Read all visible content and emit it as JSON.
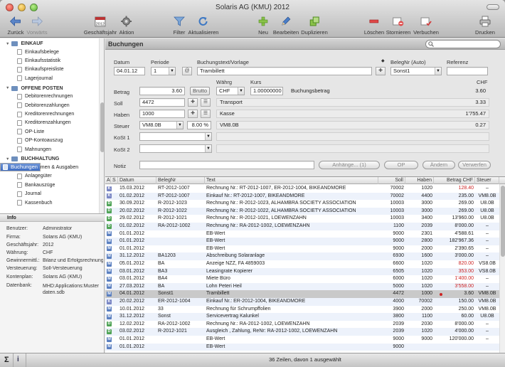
{
  "window": {
    "title": "Solaris AG (KMU) 2012"
  },
  "toolbar": {
    "items": [
      {
        "id": "back",
        "label": "Zurück",
        "icon": "back-arrow-icon",
        "enabled": true
      },
      {
        "id": "forward",
        "label": "Vorwärts",
        "icon": "forward-arrow-icon",
        "enabled": false
      },
      {
        "id": "fiscal",
        "label": "Geschäftsjahr",
        "icon": "calendar-icon",
        "enabled": true
      },
      {
        "id": "action",
        "label": "Aktion",
        "icon": "gear-icon",
        "enabled": true
      },
      {
        "id": "filter",
        "label": "Filter",
        "icon": "filter-icon",
        "enabled": true
      },
      {
        "id": "refresh",
        "label": "Aktualisieren",
        "icon": "refresh-icon",
        "enabled": true
      },
      {
        "id": "new",
        "label": "Neu",
        "icon": "plus-icon",
        "enabled": true
      },
      {
        "id": "edit",
        "label": "Bearbeiten",
        "icon": "pencil-icon",
        "enabled": true
      },
      {
        "id": "duplicate",
        "label": "Duplizieren",
        "icon": "duplicate-icon",
        "enabled": true
      },
      {
        "id": "delete",
        "label": "Löschen",
        "icon": "minus-icon",
        "enabled": true
      },
      {
        "id": "cancel",
        "label": "Stornieren",
        "icon": "cancel-icon",
        "enabled": true
      },
      {
        "id": "post",
        "label": "Verbuchen",
        "icon": "post-icon",
        "enabled": true
      },
      {
        "id": "print",
        "label": "Drucken",
        "icon": "printer-icon",
        "enabled": true
      }
    ]
  },
  "sidebar": {
    "groups": [
      {
        "title": "EINKAUF",
        "items": [
          "Einkaufsbelege",
          "Einkaufsstatistik",
          "Einkaufspreisliste",
          "Lagerjournal"
        ]
      },
      {
        "title": "OFFENE POSTEN",
        "items": [
          "Debitorenrechnungen",
          "Debitorenzahlungen",
          "Kreditorenrechnungen",
          "Kreditorenzahlungen",
          "OP-Liste",
          "OP-Kontoauszug",
          "Mahnungen"
        ]
      },
      {
        "title": "BUCHHALTUNG",
        "items": [
          "Buchungen",
          "Einnahmen & Ausgaben",
          "Anlagegüter",
          "Bankauszüge",
          "Journal",
          "Kassenbuch"
        ]
      }
    ],
    "selected": "Buchungen"
  },
  "info": {
    "title": "Info",
    "rows": [
      {
        "k": "Benutzer:",
        "v": "Administrator"
      },
      {
        "k": "Firma:",
        "v": "Solaris AG (KMU)"
      },
      {
        "k": "Geschäftsjahr:",
        "v": "2012"
      },
      {
        "k": "Währung:",
        "v": "CHF"
      },
      {
        "k": "Gewinnermittl.:",
        "v": "Bilanz und Erfolgsrechnung"
      },
      {
        "k": "Versteuerung:",
        "v": "Soll-Versteuerung"
      },
      {
        "k": "Kontenplan:",
        "v": "Solaris AG (KMU)"
      },
      {
        "k": "Datenbank:",
        "v": "MHD:Applications:Muster daten.sdb"
      }
    ]
  },
  "main": {
    "title": "Buchungen",
    "search_placeholder": ""
  },
  "form": {
    "datum_label": "Datum",
    "datum": "04.01.12",
    "periode_label": "Periode",
    "periode": "1",
    "text_label": "Buchungstext/Vorlage",
    "text": "Trambillett",
    "beleg_label": "BelegNr (Auto)",
    "beleg": "Sonst1",
    "referenz_label": "Referenz",
    "referenz": "",
    "waehrung_label": "Währg",
    "waehrung": "CHF",
    "kurs_label": "Kurs",
    "kurs": "1.00000000",
    "betrag_label": "Betrag",
    "betrag": "3.60",
    "brutto_label": "Brutto",
    "buchungsbetrag_label": "Buchungsbetrag",
    "buchungsbetrag": "3.60",
    "chf_label": "CHF",
    "soll_label": "Soll",
    "soll": "4472",
    "soll_name": "Transport",
    "soll_value": "3.33",
    "haben_label": "Haben",
    "haben": "1000",
    "haben_name": "Kasse",
    "haben_value": "1'755.47",
    "steuer_label": "Steuer",
    "steuer": "VM8.0B",
    "steuer_pct": "8.00 %",
    "steuer_code": "VM8.0B",
    "steuer_value": "0.27",
    "kost1_label": "KoSt 1",
    "kost2_label": "KoSt 2",
    "notiz_label": "Notiz",
    "btn_anhaenge": "Anhänge... (1)",
    "btn_op": "OP",
    "btn_aendern": "Ändern",
    "btn_verwerfen": "Verwerfen"
  },
  "table": {
    "columns": [
      "A",
      "S",
      "Datum",
      "BelegNr",
      "Text",
      "Soll",
      "Haben",
      "Betrag CHF",
      "Steuer"
    ],
    "rows": [
      {
        "a": "K",
        "datum": "15.03.2012",
        "beleg": "RT-2012-1007",
        "text": "Rechnung Nr.: RT-2012-1007, ER-2012-1004, BIKEANDMORE",
        "soll": "70002",
        "haben": "1020",
        "betrag": "128.40",
        "neg": true,
        "steuer": "–"
      },
      {
        "a": "K",
        "datum": "01.02.2012",
        "beleg": "RT-2012-1007",
        "text": "Einkauf Nr.: RT-2012-1007, BIKEANDMORE",
        "soll": "70002",
        "haben": "4400",
        "betrag": "235.00",
        "neg": false,
        "steuer": "VM8.0B"
      },
      {
        "a": "D",
        "datum": "30.09.2012",
        "beleg": "R-2012-1023",
        "text": "Rechnung Nr.: R-2012-1023, ALHAMBRA SOCIETY ASSOCIATION",
        "soll": "10003",
        "haben": "3000",
        "betrag": "269.00",
        "neg": false,
        "steuer": "U8.0B"
      },
      {
        "a": "D",
        "datum": "20.02.2012",
        "beleg": "R-2012-1022",
        "text": "Rechnung Nr.: R-2012-1022, ALHAMBRA SOCIETY ASSOCIATION",
        "soll": "10003",
        "haben": "3000",
        "betrag": "269.00",
        "neg": false,
        "steuer": "U8.0B"
      },
      {
        "a": "D",
        "datum": "29.02.2012",
        "beleg": "R-2012-1021",
        "text": "Rechnung Nr.: R-2012-1021, LOEWENZAHN",
        "soll": "10003",
        "haben": "3400",
        "betrag": "13'960.00",
        "neg": false,
        "steuer": "U8.0B"
      },
      {
        "a": "D",
        "datum": "01.02.2012",
        "beleg": "RA-2012-1002",
        "text": "Rechnung Nr.: RA-2012-1002, LOEWENZAHN",
        "soll": "1100",
        "haben": "2039",
        "betrag": "8'000.00",
        "neg": false,
        "steuer": "–"
      },
      {
        "a": "M",
        "datum": "01.01.2012",
        "beleg": "",
        "text": "EB-Wert",
        "soll": "9000",
        "haben": "2301",
        "betrag": "4'588.61",
        "neg": false,
        "steuer": "–"
      },
      {
        "a": "M",
        "datum": "01.01.2012",
        "beleg": "",
        "text": "EB-Wert",
        "soll": "9000",
        "haben": "2800",
        "betrag": "182'967.36",
        "neg": false,
        "steuer": "–"
      },
      {
        "a": "M",
        "datum": "01.01.2012",
        "beleg": "",
        "text": "EB-Wert",
        "soll": "9000",
        "haben": "2000",
        "betrag": "2'390.65",
        "neg": false,
        "steuer": "–"
      },
      {
        "a": "M",
        "datum": "31.12.2012",
        "beleg": "BA1203",
        "text": "Abschreibung Solaranlage",
        "soll": "6930",
        "haben": "1600",
        "betrag": "3'000.00",
        "neg": false,
        "steuer": "–"
      },
      {
        "a": "M",
        "datum": "05.01.2012",
        "beleg": "BA",
        "text": "Anzeige NZZ, FA 4859003",
        "soll": "6600",
        "haben": "1020",
        "betrag": "820.00",
        "neg": true,
        "steuer": "VS8.0B"
      },
      {
        "a": "M",
        "datum": "03.01.2012",
        "beleg": "BA3",
        "text": "Leasingrate Kopierer",
        "soll": "6505",
        "haben": "1020",
        "betrag": "353.00",
        "neg": true,
        "steuer": "VS8.0B"
      },
      {
        "a": "M",
        "datum": "03.01.2012",
        "beleg": "BA4",
        "text": "Miete Büro",
        "soll": "6000",
        "haben": "1020",
        "betrag": "1'400.00",
        "neg": true,
        "steuer": "–"
      },
      {
        "a": "M",
        "datum": "27.03.2012",
        "beleg": "BA",
        "text": "Lohn Peteri Heil",
        "soll": "5000",
        "haben": "1020",
        "betrag": "3'558.00",
        "neg": true,
        "steuer": "–"
      },
      {
        "a": "M",
        "datum": "04.01.2012",
        "beleg": "Sonst1",
        "text": "Trambillett",
        "soll": "4472",
        "haben": "1000",
        "betrag": "3.60",
        "neg": false,
        "steuer": "VM8.0B",
        "selected": true
      },
      {
        "a": "K",
        "datum": "20.02.2012",
        "beleg": "ER-2012-1004",
        "text": "Einkauf Nr.: ER-2012-1004, BIKEANDMORE",
        "soll": "4000",
        "haben": "70002",
        "betrag": "150.00",
        "neg": false,
        "steuer": "VM8.0B"
      },
      {
        "a": "M",
        "datum": "10.01.2012",
        "beleg": "33",
        "text": "Rechnung für Schrumpffolien",
        "soll": "3900",
        "haben": "2000",
        "betrag": "250.00",
        "neg": false,
        "steuer": "VM8.0B"
      },
      {
        "a": "M",
        "datum": "31.12.2012",
        "beleg": "Sonst",
        "text": "Servicevertrag Kalunkel",
        "soll": "3800",
        "haben": "1100",
        "betrag": "60.00",
        "neg": false,
        "steuer": "U8.0B"
      },
      {
        "a": "D",
        "datum": "12.02.2012",
        "beleg": "RA-2012-1002",
        "text": "Rechnung Nr.: RA-2012-1002, LOEWENZAHN",
        "soll": "2039",
        "haben": "2030",
        "betrag": "8'000.00",
        "neg": false,
        "steuer": "–"
      },
      {
        "a": "D",
        "datum": "03.02.2012",
        "beleg": "R-2012-1021",
        "text": "Ausgleich , Zahlung, ReNr: RA-2012-1002, LOEWENZAHN",
        "soll": "2039",
        "haben": "1020",
        "betrag": "4'000.00",
        "neg": false,
        "steuer": "–"
      },
      {
        "a": "M",
        "datum": "01.01.2012",
        "beleg": "",
        "text": "EB-Wert",
        "soll": "9000",
        "haben": "9000",
        "betrag": "120'000.00",
        "neg": false,
        "steuer": "–"
      },
      {
        "a": "M",
        "datum": "01.01.2012",
        "beleg": "",
        "text": "EB-Wert",
        "soll": "9000",
        "haben": "",
        "betrag": "",
        "neg": false,
        "steuer": ""
      }
    ]
  },
  "status": "36 Zeilen, davon 1 ausgewählt",
  "colors": {
    "selection": "#3e6cc2",
    "negative": "#cc2222",
    "badge_K": "#7a86c4",
    "badge_D": "#4fa356",
    "badge_M": "#5a7fc0"
  }
}
